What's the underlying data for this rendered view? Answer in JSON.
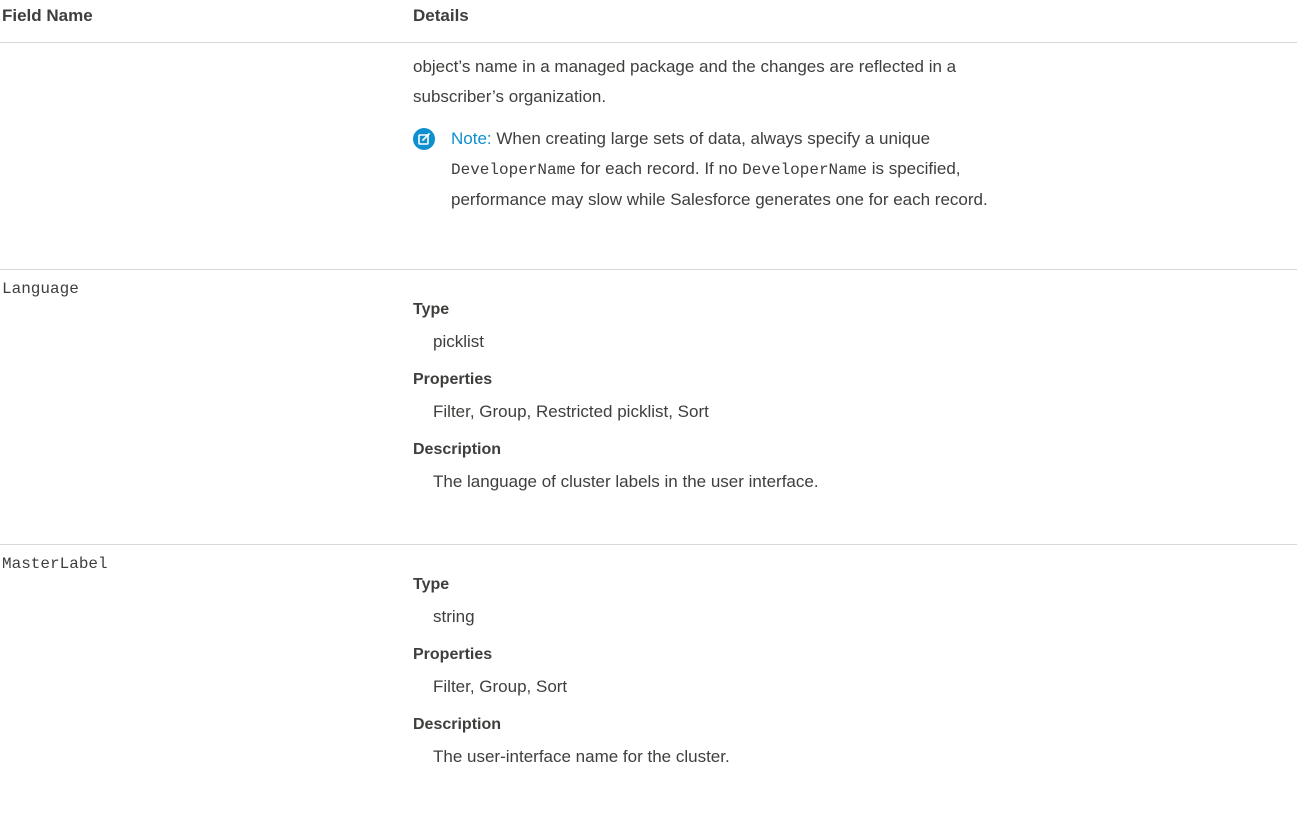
{
  "table": {
    "headers": {
      "field_name": "Field Name",
      "details": "Details"
    },
    "continuation": {
      "text": "object’s name in a managed package and the changes are reflected in a subscriber’s organization.",
      "text_line1": "object’s name in a managed package and the changes are reflected in a",
      "text_line2": "subscriber’s organization.",
      "note": {
        "label": "Note:",
        "part1": " When creating large sets of data, always specify a unique",
        "code1": "DeveloperName",
        "part2": " for each record. If no ",
        "code2": "DeveloperName",
        "part3": " is specified,",
        "part4": "performance may slow while Salesforce generates one for each record."
      }
    },
    "rows": [
      {
        "field": "Language",
        "type_label": "Type",
        "type": "picklist",
        "properties_label": "Properties",
        "properties": "Filter, Group, Restricted picklist, Sort",
        "description_label": "Description",
        "description": "The language of cluster labels in the user interface."
      },
      {
        "field": "MasterLabel",
        "type_label": "Type",
        "type": "string",
        "properties_label": "Properties",
        "properties": "Filter, Group, Sort",
        "description_label": "Description",
        "description": "The user-interface name for the cluster."
      }
    ]
  },
  "icons": {
    "note": "edit-note-icon"
  },
  "colors": {
    "note_accent": "#0e8fcf",
    "text": "#3e3e3c",
    "divider": "#d8d8d8"
  }
}
